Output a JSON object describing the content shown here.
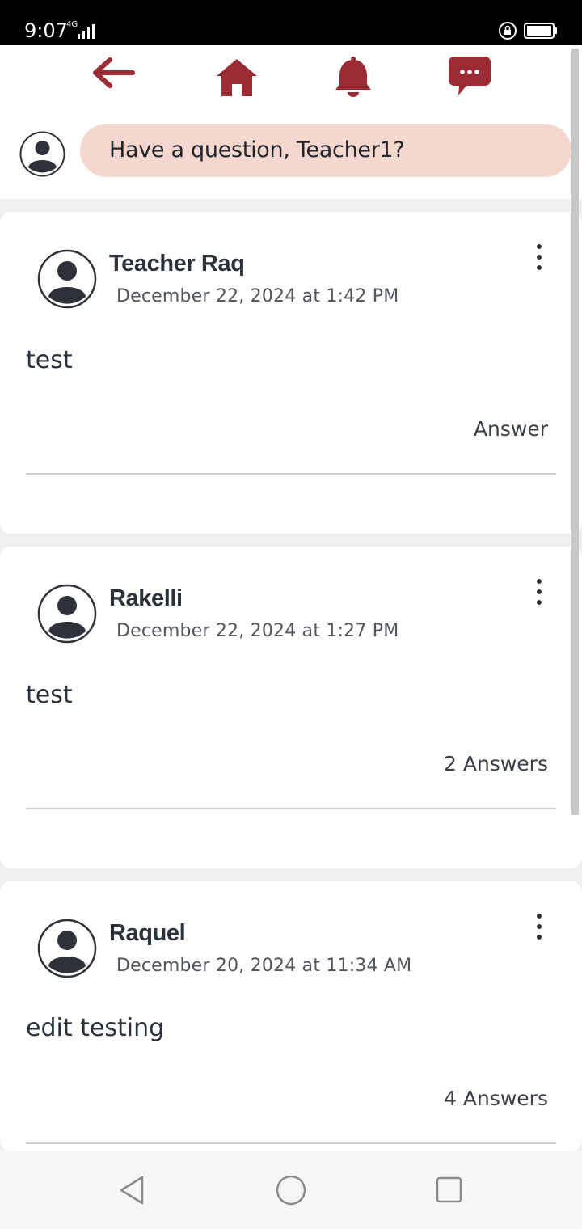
{
  "status_bar": {
    "time": "9:07",
    "network": "4G"
  },
  "colors": {
    "accent": "#9b2b35",
    "ask_bubble": "#f4d7cf",
    "text_dark": "#2c3239"
  },
  "top_nav": {
    "icons": [
      "back-arrow-icon",
      "home-icon",
      "bell-icon",
      "chat-icon"
    ]
  },
  "ask": {
    "placeholder": "Have a question, Teacher1?"
  },
  "posts": [
    {
      "author": "Teacher Raq",
      "date": "December 22, 2024 at 1:42 PM",
      "body": "test",
      "answers": "Answer"
    },
    {
      "author": "Rakelli",
      "date": "December 22, 2024 at 1:27 PM",
      "body": "test",
      "answers": "2 Answers"
    },
    {
      "author": "Raquel",
      "date": "December 20, 2024 at 11:34 AM",
      "body": "edit testing",
      "answers": "4 Answers"
    }
  ],
  "system_nav": {
    "icons": [
      "back-triangle-icon",
      "home-circle-icon",
      "recents-square-icon"
    ]
  }
}
